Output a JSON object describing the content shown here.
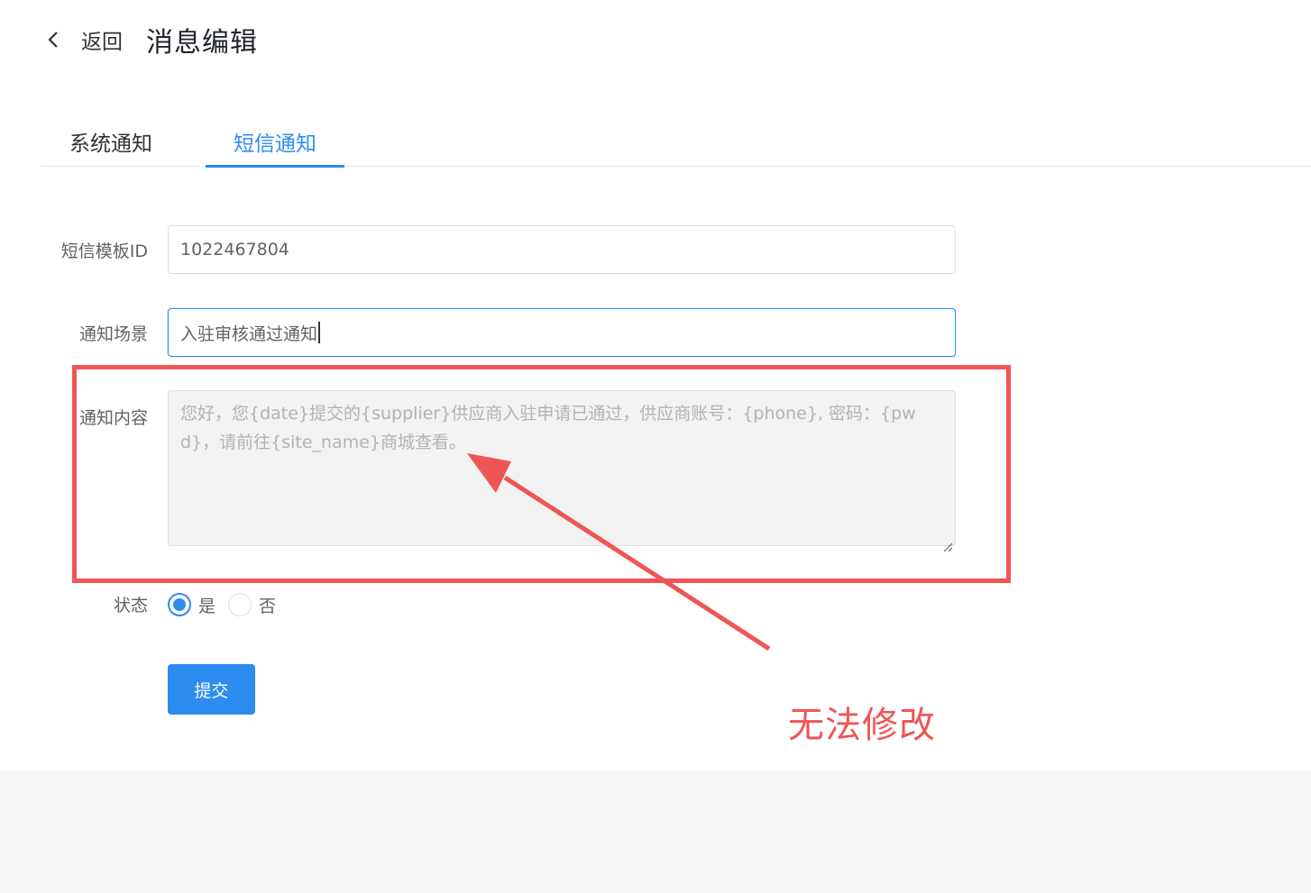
{
  "header": {
    "back_label": "返回",
    "title": "消息编辑"
  },
  "tabs": [
    {
      "label": "系统通知",
      "active": false
    },
    {
      "label": "短信通知",
      "active": true
    }
  ],
  "form": {
    "template_id": {
      "label": "短信模板ID",
      "value": "1022467804"
    },
    "scene": {
      "label": "通知场景",
      "value": "入驻审核通过通知"
    },
    "content": {
      "label": "通知内容",
      "value": "您好，您{date}提交的{supplier}供应商入驻申请已通过，供应商账号：{phone}, 密码：{pwd}，请前往{site_name}商城查看。",
      "disabled": true
    },
    "status": {
      "label": "状态",
      "options": [
        "是",
        "否"
      ],
      "selected": "是"
    },
    "submit_label": "提交"
  },
  "annotation": {
    "text": "无法修改",
    "color": "#f05555"
  },
  "colors": {
    "accent": "#2d8cf0",
    "annotation": "#f05555"
  }
}
